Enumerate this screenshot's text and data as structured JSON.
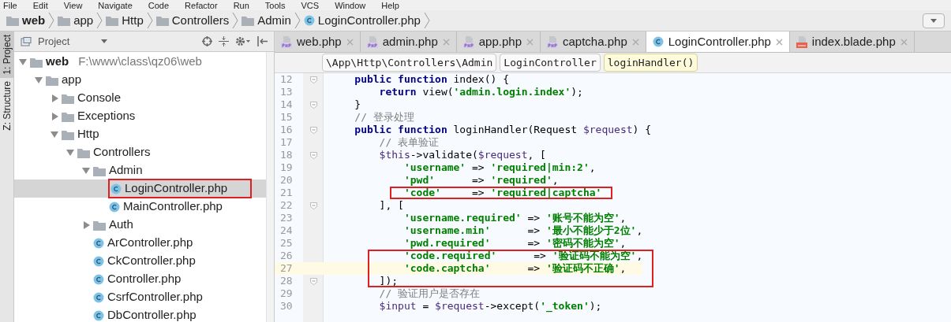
{
  "menu": [
    "File",
    "Edit",
    "View",
    "Navigate",
    "Code",
    "Refactor",
    "Run",
    "Tools",
    "VCS",
    "Window",
    "Help"
  ],
  "breadcrumbs": [
    {
      "label": "web",
      "kind": "folder",
      "bold": true
    },
    {
      "label": "app",
      "kind": "folder",
      "bold": false
    },
    {
      "label": "Http",
      "kind": "folder",
      "bold": false
    },
    {
      "label": "Controllers",
      "kind": "folder",
      "bold": false
    },
    {
      "label": "Admin",
      "kind": "folder",
      "bold": false
    },
    {
      "label": "LoginController.php",
      "kind": "class",
      "bold": false
    }
  ],
  "side_tabs": [
    {
      "label": "1: Project",
      "selected": true
    },
    {
      "label": "Z: Structure",
      "selected": false
    }
  ],
  "project_panel": {
    "title": "Project",
    "tree": [
      {
        "label": "web",
        "path": "F:\\www\\class\\qz06\\web",
        "kind": "folder",
        "expanded": true,
        "selected": false,
        "boxed": false,
        "children": [
          {
            "label": "app",
            "kind": "folder",
            "expanded": true,
            "selected": false,
            "boxed": false,
            "children": [
              {
                "label": "Console",
                "kind": "folder",
                "expanded": false,
                "selected": false,
                "boxed": false
              },
              {
                "label": "Exceptions",
                "kind": "folder",
                "expanded": false,
                "selected": false,
                "boxed": false
              },
              {
                "label": "Http",
                "kind": "folder",
                "expanded": true,
                "selected": false,
                "boxed": false,
                "children": [
                  {
                    "label": "Controllers",
                    "kind": "folder",
                    "expanded": true,
                    "selected": false,
                    "boxed": false,
                    "children": [
                      {
                        "label": "Admin",
                        "kind": "folder",
                        "expanded": true,
                        "selected": false,
                        "boxed": false,
                        "children": [
                          {
                            "label": "LoginController.php",
                            "kind": "class",
                            "selected": true,
                            "boxed": true
                          },
                          {
                            "label": "MainController.php",
                            "kind": "class",
                            "selected": false,
                            "boxed": false
                          }
                        ]
                      },
                      {
                        "label": "Auth",
                        "kind": "folder",
                        "expanded": false,
                        "selected": false,
                        "boxed": false
                      },
                      {
                        "label": "ArController.php",
                        "kind": "class",
                        "selected": false,
                        "boxed": false
                      },
                      {
                        "label": "CkController.php",
                        "kind": "class",
                        "selected": false,
                        "boxed": false
                      },
                      {
                        "label": "Controller.php",
                        "kind": "class",
                        "selected": false,
                        "boxed": false
                      },
                      {
                        "label": "CsrfController.php",
                        "kind": "class",
                        "selected": false,
                        "boxed": false
                      },
                      {
                        "label": "DbController.php",
                        "kind": "class",
                        "selected": false,
                        "boxed": false
                      }
                    ]
                  }
                ]
              }
            ]
          }
        ]
      }
    ]
  },
  "editor_tabs": [
    {
      "label": "web.php",
      "kind": "php",
      "selected": false
    },
    {
      "label": "admin.php",
      "kind": "php",
      "selected": false
    },
    {
      "label": "app.php",
      "kind": "php",
      "selected": false
    },
    {
      "label": "captcha.php",
      "kind": "php",
      "selected": false
    },
    {
      "label": "LoginController.php",
      "kind": "class",
      "selected": true
    },
    {
      "label": "index.blade.php",
      "kind": "blade",
      "selected": false
    }
  ],
  "editor_breadcrumbs": [
    {
      "label": "\\App\\Http\\Controllers\\Admin",
      "selected": false
    },
    {
      "label": "LoginController",
      "selected": false
    },
    {
      "label": "loginHandler()",
      "selected": true
    }
  ],
  "code_lines": [
    {
      "number": "12",
      "fold": true,
      "current": false,
      "boxed": false,
      "segments": [
        {
          "kind": "keyword",
          "text": "    public function "
        },
        {
          "kind": "plain",
          "text": "index() {"
        }
      ]
    },
    {
      "number": "13",
      "fold": false,
      "current": false,
      "boxed": false,
      "segments": [
        {
          "kind": "keyword",
          "text": "        return "
        },
        {
          "kind": "plain",
          "text": "view("
        },
        {
          "kind": "string",
          "text": "'admin.login.index'"
        },
        {
          "kind": "plain",
          "text": ");"
        }
      ]
    },
    {
      "number": "14",
      "fold": true,
      "current": false,
      "boxed": false,
      "segments": [
        {
          "kind": "plain",
          "text": "    }"
        }
      ]
    },
    {
      "number": "15",
      "fold": false,
      "current": false,
      "boxed": false,
      "segments": [
        {
          "kind": "comment",
          "text": "    // 登录处理"
        }
      ]
    },
    {
      "number": "16",
      "fold": true,
      "current": false,
      "boxed": false,
      "segments": [
        {
          "kind": "keyword",
          "text": "    public function "
        },
        {
          "kind": "plain",
          "text": "loginHandler(Request "
        },
        {
          "kind": "variable",
          "text": "$request"
        },
        {
          "kind": "plain",
          "text": ") {"
        }
      ]
    },
    {
      "number": "17",
      "fold": false,
      "current": false,
      "boxed": false,
      "segments": [
        {
          "kind": "comment",
          "text": "        // 表单验证"
        }
      ]
    },
    {
      "number": "18",
      "fold": true,
      "current": false,
      "boxed": false,
      "segments": [
        {
          "kind": "variable",
          "text": "        $this"
        },
        {
          "kind": "plain",
          "text": "->validate("
        },
        {
          "kind": "variable",
          "text": "$request"
        },
        {
          "kind": "plain",
          "text": ", ["
        }
      ]
    },
    {
      "number": "19",
      "fold": false,
      "current": false,
      "boxed": false,
      "segments": [
        {
          "kind": "string",
          "text": "            'username'"
        },
        {
          "kind": "plain",
          "text": " => "
        },
        {
          "kind": "string",
          "text": "'required|min:2'"
        },
        {
          "kind": "plain",
          "text": ","
        }
      ]
    },
    {
      "number": "20",
      "fold": false,
      "current": false,
      "boxed": false,
      "segments": [
        {
          "kind": "string",
          "text": "            'pwd'"
        },
        {
          "kind": "plain",
          "text": "      => "
        },
        {
          "kind": "string",
          "text": "'required'"
        },
        {
          "kind": "plain",
          "text": ","
        }
      ]
    },
    {
      "number": "21",
      "fold": false,
      "current": false,
      "boxed": true,
      "segments": [
        {
          "kind": "string",
          "text": "            'code'"
        },
        {
          "kind": "plain",
          "text": "     => "
        },
        {
          "kind": "string",
          "text": "'required|captcha'"
        }
      ]
    },
    {
      "number": "22",
      "fold": true,
      "current": false,
      "boxed": false,
      "segments": [
        {
          "kind": "plain",
          "text": "        ], ["
        }
      ]
    },
    {
      "number": "23",
      "fold": false,
      "current": false,
      "boxed": false,
      "segments": [
        {
          "kind": "string",
          "text": "            'username.required'"
        },
        {
          "kind": "plain",
          "text": " => "
        },
        {
          "kind": "string",
          "text": "'账号不能为空'"
        },
        {
          "kind": "plain",
          "text": ","
        }
      ]
    },
    {
      "number": "24",
      "fold": false,
      "current": false,
      "boxed": false,
      "segments": [
        {
          "kind": "string",
          "text": "            'username.min'"
        },
        {
          "kind": "plain",
          "text": "      => "
        },
        {
          "kind": "string",
          "text": "'最小不能少于2位'"
        },
        {
          "kind": "plain",
          "text": ","
        }
      ]
    },
    {
      "number": "25",
      "fold": false,
      "current": false,
      "boxed": false,
      "segments": [
        {
          "kind": "string",
          "text": "            'pwd.required'"
        },
        {
          "kind": "plain",
          "text": "      => "
        },
        {
          "kind": "string",
          "text": "'密码不能为空'"
        },
        {
          "kind": "plain",
          "text": ","
        }
      ]
    },
    {
      "number": "26",
      "fold": false,
      "current": false,
      "boxed": true,
      "segments": [
        {
          "kind": "string",
          "text": "            'code.required'"
        },
        {
          "kind": "plain",
          "text": "      => "
        },
        {
          "kind": "string",
          "text": "'验证码不能为空'"
        },
        {
          "kind": "plain",
          "text": ","
        }
      ]
    },
    {
      "number": "27",
      "fold": false,
      "current": true,
      "boxed": true,
      "segments": [
        {
          "kind": "string",
          "text": "            'code.captcha'"
        },
        {
          "kind": "plain",
          "text": "      => "
        },
        {
          "kind": "string",
          "text": "'验证码不正确'"
        },
        {
          "kind": "plain",
          "text": ","
        }
      ]
    },
    {
      "number": "28",
      "fold": true,
      "current": false,
      "boxed": true,
      "segments": [
        {
          "kind": "plain",
          "text": "        ]);"
        }
      ]
    },
    {
      "number": "29",
      "fold": false,
      "current": false,
      "boxed": false,
      "segments": [
        {
          "kind": "comment",
          "text": "        // 验证用户是否存在"
        }
      ]
    },
    {
      "number": "30",
      "fold": false,
      "current": false,
      "boxed": false,
      "segments": [
        {
          "kind": "variable",
          "text": "        $input"
        },
        {
          "kind": "plain",
          "text": " = "
        },
        {
          "kind": "variable",
          "text": "$request"
        },
        {
          "kind": "plain",
          "text": "->except("
        },
        {
          "kind": "string",
          "text": "'_token'"
        },
        {
          "kind": "plain",
          "text": ");"
        }
      ]
    }
  ]
}
